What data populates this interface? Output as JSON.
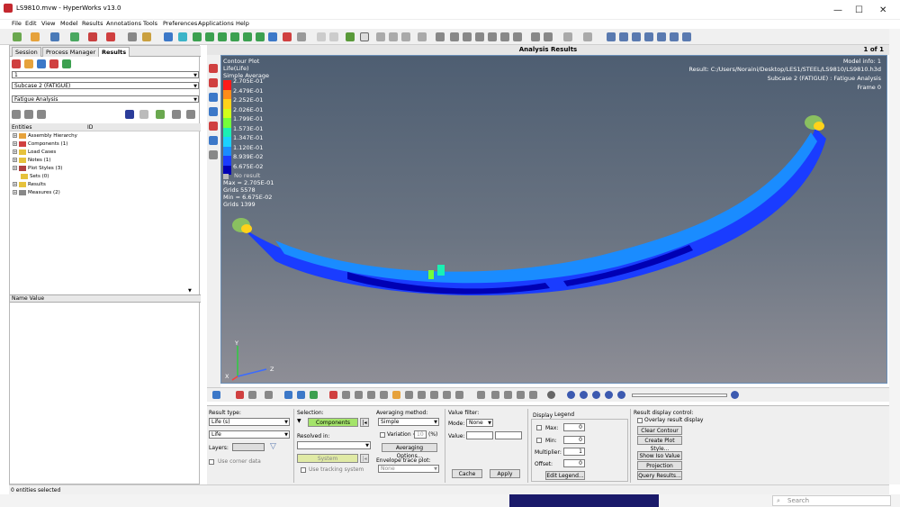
{
  "window": {
    "title": "LS9810.mvw - HyperWorks v13.0",
    "minimize": "—",
    "maximize": "☐",
    "close": "✕"
  },
  "menu": [
    "File",
    "Edit",
    "View",
    "Model",
    "Results",
    "Annotations",
    "Tools",
    "Preferences",
    "Applications",
    "Help"
  ],
  "tabs": {
    "session": "Session",
    "process_manager": "Process Manager",
    "results": "Results"
  },
  "left": {
    "combo1": "1",
    "subcase": "Subcase 2 (FATIGUE)",
    "analysis": "Fatigue Analysis",
    "entities_header": "Entities",
    "id_label": "ID",
    "tree": [
      "Assembly Hierarchy",
      "Components (1)",
      "Load Cases",
      "Notes (1)",
      "Plot Styles (3)",
      "Sets (0)",
      "Results",
      "Measures (2)"
    ],
    "name_value_header": "Name Value"
  },
  "viewport": {
    "title": "Analysis Results",
    "page": "1 of 1",
    "legend": {
      "line1": "Contour Plot",
      "line2": "Life(Life)",
      "line3": "Simple Average",
      "values": [
        "2.705E-01",
        "2.479E-01",
        "2.252E-01",
        "2.026E-01",
        "1.799E-01",
        "1.573E-01",
        "1.347E-01",
        "1.120E-01",
        "8.939E-02",
        "6.675E-02"
      ],
      "colors": [
        "#ff1a1a",
        "#ff8c1a",
        "#ffd21a",
        "#d2ff1a",
        "#74ff3a",
        "#1af0b4",
        "#1ad2ff",
        "#1a8cff",
        "#1a3cff",
        "#0000b4"
      ],
      "no_result": "No result",
      "max": "Max = 2.705E-01",
      "grids_max": "Grids 5578",
      "min": "Min = 6.675E-02",
      "grids_min": "Grids 1399"
    },
    "info": {
      "model": "Model info: 1",
      "result": "Result: C:/Users/Noraini/Desktop/LES1/STEEL/LS9810/LS9810.h3d",
      "subcase": "Subcase 2 (FATIGUE) : Fatigue Analysis",
      "frame": "Frame 0"
    },
    "axes": {
      "y": "Y",
      "z": "Z",
      "x": "X"
    }
  },
  "panel": {
    "result_type_label": "Result type:",
    "result_type_value": "Life (s)",
    "result_sub_value": "Life",
    "layers_label": "Layers:",
    "use_corner_data": "Use corner data",
    "selection_label": "Selection:",
    "components_btn": "Components",
    "resolved_in_label": "Resolved in:",
    "system_btn": "System",
    "use_tracking": "Use tracking system",
    "averaging_label": "Averaging method:",
    "averaging_value": "Simple",
    "variation_label": "Variation <",
    "variation_value": "10",
    "variation_unit": "(%)",
    "averaging_options": "Averaging Options...",
    "envelope_label": "Envelope trace plot:",
    "envelope_value": "None",
    "value_filter_label": "Value filter:",
    "mode_label": "Mode:",
    "mode_value": "None",
    "value_label": "Value:",
    "cache_btn": "Cache",
    "apply_btn": "Apply",
    "display_label": "Display",
    "legend_label": "Legend",
    "max_label": "Max:",
    "max_value": "0",
    "min_label": "Min:",
    "min_value": "0",
    "multiplier_label": "Multiplier:",
    "multiplier_value": "1",
    "offset_label": "Offset:",
    "offset_value": "0",
    "edit_legend": "Edit Legend...",
    "rdc_label": "Result display control:",
    "overlay_label": "Overlay result display",
    "clear_contour": "Clear Contour",
    "create_plot_style": "Create Plot Style...",
    "show_iso_value": "Show Iso Value",
    "projection_rule": "Projection Rule...",
    "query_results": "Query Results..."
  },
  "status": "0 entities selected",
  "taskbar_search": "Search"
}
